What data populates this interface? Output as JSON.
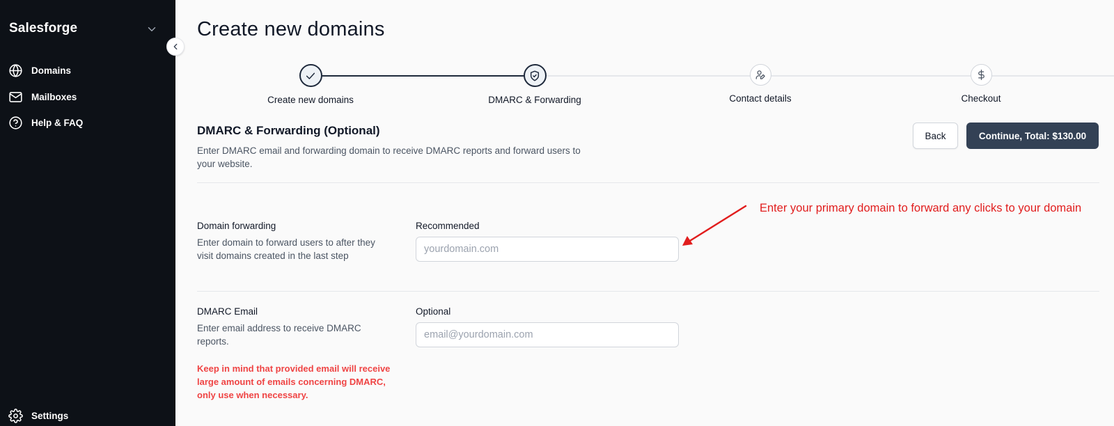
{
  "sidebar": {
    "brand": "Salesforge",
    "items": [
      {
        "label": "Domains",
        "icon": "globe-icon"
      },
      {
        "label": "Mailboxes",
        "icon": "mail-icon"
      },
      {
        "label": "Help & FAQ",
        "icon": "help-icon"
      }
    ],
    "settings_label": "Settings"
  },
  "page": {
    "title": "Create new domains"
  },
  "stepper": {
    "steps": [
      {
        "label": "Create new domains",
        "state": "complete",
        "icon": "check-icon"
      },
      {
        "label": "DMARC & Forwarding",
        "state": "current",
        "icon": "shield-icon"
      },
      {
        "label": "Contact details",
        "state": "upcoming",
        "icon": "user-edit-icon"
      },
      {
        "label": "Checkout",
        "state": "upcoming",
        "icon": "dollar-icon"
      }
    ]
  },
  "section": {
    "title": "DMARC & Forwarding (Optional)",
    "description": "Enter DMARC email and forwarding domain to receive DMARC reports and forward users to your website."
  },
  "actions": {
    "back_label": "Back",
    "continue_label": "Continue, Total: $130.00"
  },
  "forwarding": {
    "title": "Domain forwarding",
    "description": "Enter domain to forward users to after they visit domains created in the last step",
    "field_label": "Recommended",
    "placeholder": "yourdomain.com",
    "value": ""
  },
  "dmarc": {
    "title": "DMARC Email",
    "description": "Enter email address to receive DMARC reports.",
    "field_label": "Optional",
    "placeholder": "email@yourdomain.com",
    "value": "",
    "warning": "Keep in mind that provided email will receive large amount of emails concerning DMARC, only use when necessary."
  },
  "annotation": {
    "text": "Enter your primary domain to forward any clicks to your domain",
    "color": "#e11d1d"
  },
  "colors": {
    "sidebar_bg": "#0d1117",
    "primary_button": "#334155",
    "warning": "#ef4444"
  }
}
